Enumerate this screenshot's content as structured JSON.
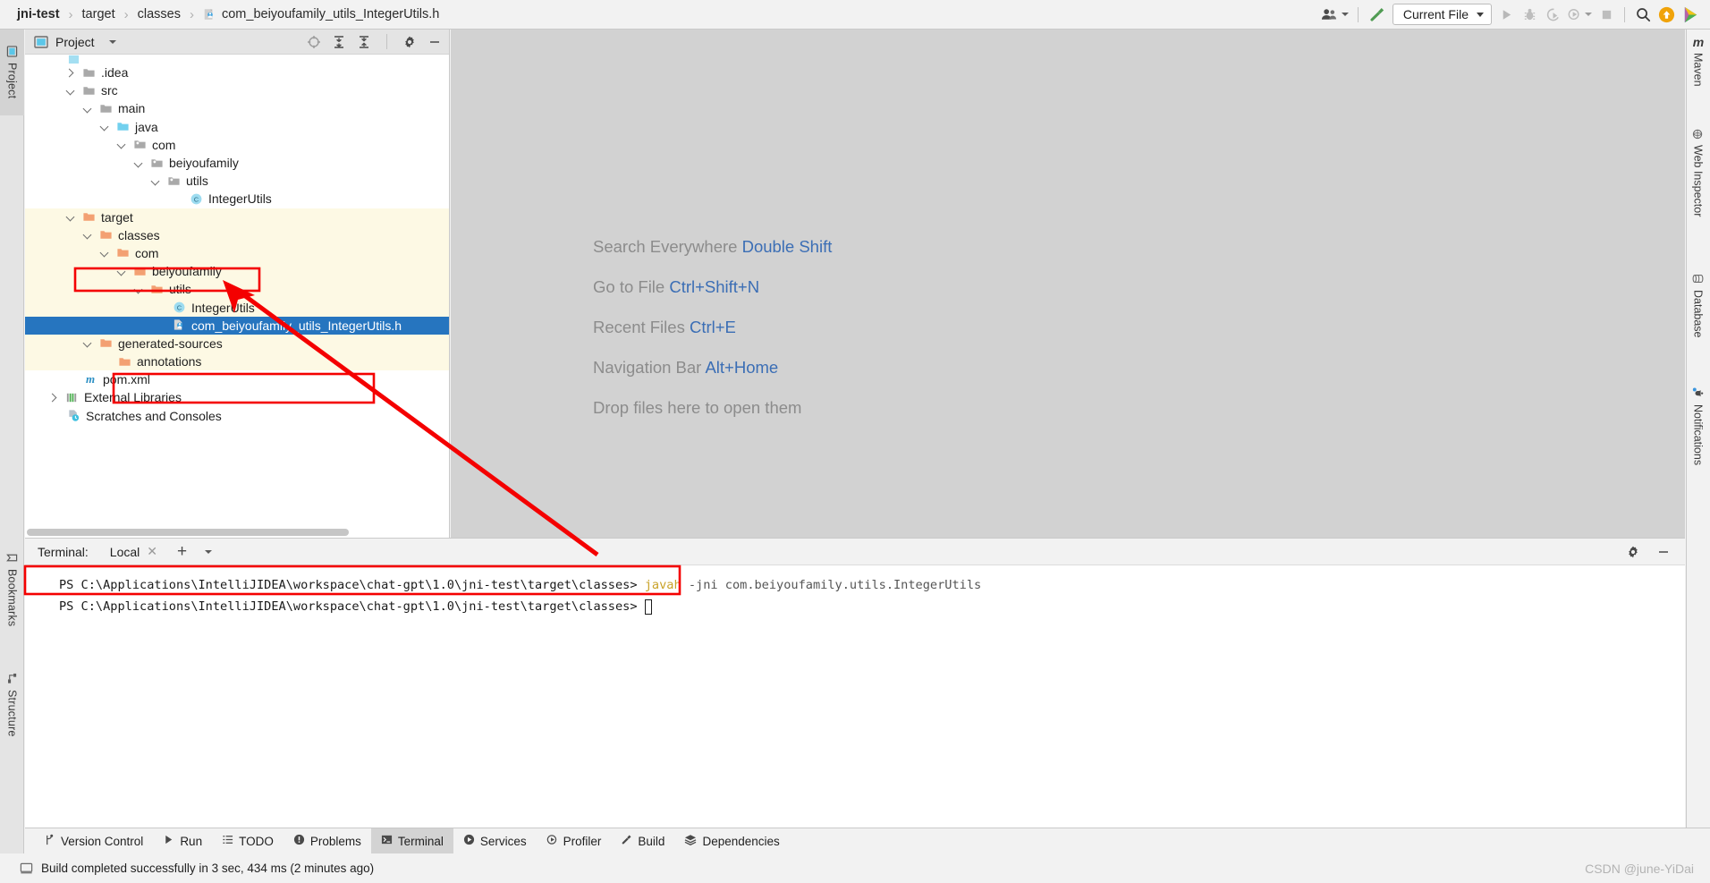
{
  "navbar": {
    "breadcrumbs": [
      {
        "label": "jni-test",
        "bold": true
      },
      {
        "label": "target",
        "bold": false
      },
      {
        "label": "classes",
        "bold": false
      },
      {
        "label": "com_beiyoufamily_utils_IntegerUtils.h",
        "bold": false,
        "icon": "c-header-file-icon"
      }
    ],
    "separator": "›",
    "account_icon": "account-icon",
    "build_icon": "hammer-build-icon",
    "run_config": {
      "label": "Current File",
      "chevron": "chevron-down-icon"
    },
    "run_icon": "run-icon",
    "debug_icon": "debug-icon",
    "run_with_coverage_icon": "run-coverage-icon",
    "profiler_icon": "profiler-icon",
    "stop_icon": "stop-icon",
    "search_icon": "search-icon",
    "update_icon": "update-arrow-icon",
    "ide_icon": "ide-logo-icon"
  },
  "left_stripe": {
    "items": [
      {
        "label": "Project",
        "selected": true,
        "icon": "project-icon"
      },
      {
        "label": "Bookmarks",
        "selected": false,
        "icon": "bookmarks-icon"
      },
      {
        "label": "Structure",
        "selected": false,
        "icon": "structure-icon"
      }
    ]
  },
  "right_stripe": {
    "items": [
      {
        "label": "Maven",
        "icon": "maven-icon"
      },
      {
        "label": "Web Inspector",
        "icon": "globe-icon"
      },
      {
        "label": "Database",
        "icon": "database-icon"
      },
      {
        "label": "Notifications",
        "icon": "bell-icon"
      }
    ]
  },
  "project_panel": {
    "title": "Project",
    "title_chevron": "chevron-down-icon",
    "toolbar_icons": [
      "locate-target-icon",
      "expand-all-icon",
      "collapse-all-icon",
      "gear-icon",
      "minimize-icon"
    ],
    "tree": [
      {
        "label": ".idea",
        "depth": 1,
        "arrow": "right",
        "icon": "folder-icon",
        "style": "normal"
      },
      {
        "label": "src",
        "depth": 1,
        "arrow": "down",
        "icon": "folder-icon",
        "style": "normal"
      },
      {
        "label": "main",
        "depth": 2,
        "arrow": "down",
        "icon": "folder-icon",
        "style": "normal"
      },
      {
        "label": "java",
        "depth": 3,
        "arrow": "down",
        "icon": "source-folder-icon",
        "style": "normal"
      },
      {
        "label": "com",
        "depth": 4,
        "arrow": "down",
        "icon": "package-icon",
        "style": "normal"
      },
      {
        "label": "beiyoufamily",
        "depth": 5,
        "arrow": "down",
        "icon": "package-icon",
        "style": "normal"
      },
      {
        "label": "utils",
        "depth": 6,
        "arrow": "down",
        "icon": "package-icon",
        "style": "normal"
      },
      {
        "label": "IntegerUtils",
        "depth": 7,
        "arrow": "none",
        "icon": "java-class-icon",
        "style": "normal"
      },
      {
        "label": "target",
        "depth": 1,
        "arrow": "down",
        "icon": "excluded-folder-icon",
        "style": "excluded"
      },
      {
        "label": "classes",
        "depth": 2,
        "arrow": "down",
        "icon": "excluded-folder-icon",
        "style": "excluded"
      },
      {
        "label": "com",
        "depth": 3,
        "arrow": "down",
        "icon": "excluded-folder-icon",
        "style": "excluded"
      },
      {
        "label": "beiyoufamily",
        "depth": 4,
        "arrow": "down",
        "icon": "excluded-folder-icon",
        "style": "excluded"
      },
      {
        "label": "utils",
        "depth": 5,
        "arrow": "down",
        "icon": "excluded-folder-icon",
        "style": "excluded"
      },
      {
        "label": "IntegerUtils",
        "depth": 6,
        "arrow": "none",
        "icon": "java-class-icon",
        "style": "excluded"
      },
      {
        "label": "com_beiyoufamily_utils_IntegerUtils.h",
        "depth": 6,
        "arrow": "none",
        "icon": "c-header-file-icon",
        "style": "selected"
      },
      {
        "label": "generated-sources",
        "depth": 2,
        "arrow": "down",
        "icon": "excluded-folder-icon",
        "style": "excluded"
      },
      {
        "label": "annotations",
        "depth": 3,
        "arrow": "none",
        "icon": "excluded-folder-icon",
        "style": "excluded"
      },
      {
        "label": "pom.xml",
        "depth": 1,
        "arrow": "none",
        "icon": "maven-pom-icon",
        "style": "normal"
      },
      {
        "label": "External Libraries",
        "depth": 0,
        "arrow": "right",
        "icon": "libraries-icon",
        "style": "normal"
      },
      {
        "label": "Scratches and Consoles",
        "depth": 0,
        "arrow": "none",
        "icon": "scratches-icon",
        "style": "normal"
      }
    ]
  },
  "editor": {
    "hints": [
      {
        "text": "Search Everywhere",
        "shortcut": "Double Shift"
      },
      {
        "text": "Go to File",
        "shortcut": "Ctrl+Shift+N"
      },
      {
        "text": "Recent Files",
        "shortcut": "Ctrl+E"
      },
      {
        "text": "Navigation Bar",
        "shortcut": "Alt+Home"
      },
      {
        "text": "Drop files here to open them",
        "shortcut": ""
      }
    ]
  },
  "terminal": {
    "label": "Terminal:",
    "tab": "Local",
    "close_icon": "close-icon",
    "add_icon": "plus-icon",
    "dropdown_icon": "chevron-down-icon",
    "settings_icon": "gear-icon",
    "minimize_icon": "minimize-icon",
    "lines": [
      {
        "prompt": "PS C:\\Applications\\IntelliJIDEA\\workspace\\chat-gpt\\1.0\\jni-test\\target\\classes>",
        "command": "javah",
        "args": "-jni com.beiyoufamily.utils.IntegerUtils",
        "cursor": false
      },
      {
        "prompt": "PS C:\\Applications\\IntelliJIDEA\\workspace\\chat-gpt\\1.0\\jni-test\\target\\classes>",
        "command": "",
        "args": "",
        "cursor": true
      }
    ]
  },
  "bottom_tabs": [
    {
      "label": "Version Control",
      "icon": "version-control-icon",
      "active": false
    },
    {
      "label": "Run",
      "icon": "run-icon",
      "active": false
    },
    {
      "label": "TODO",
      "icon": "todo-icon",
      "active": false
    },
    {
      "label": "Problems",
      "icon": "problems-icon",
      "active": false
    },
    {
      "label": "Terminal",
      "icon": "terminal-icon",
      "active": true
    },
    {
      "label": "Services",
      "icon": "services-icon",
      "active": false
    },
    {
      "label": "Profiler",
      "icon": "profiler-icon",
      "active": false
    },
    {
      "label": "Build",
      "icon": "build-hammer-icon",
      "active": false
    },
    {
      "label": "Dependencies",
      "icon": "dependencies-icon",
      "active": false
    }
  ],
  "statusbar": {
    "icon": "build-status-icon",
    "message": "Build completed successfully in 3 sec, 434 ms (2 minutes ago)",
    "watermark": "CSDN @june-YiDai"
  },
  "colors": {
    "accent_blue": "#2675bf",
    "annotation_red": "#f40000",
    "excluded_bg": "#fdf9e4",
    "hint_link": "#3b6eb5"
  }
}
